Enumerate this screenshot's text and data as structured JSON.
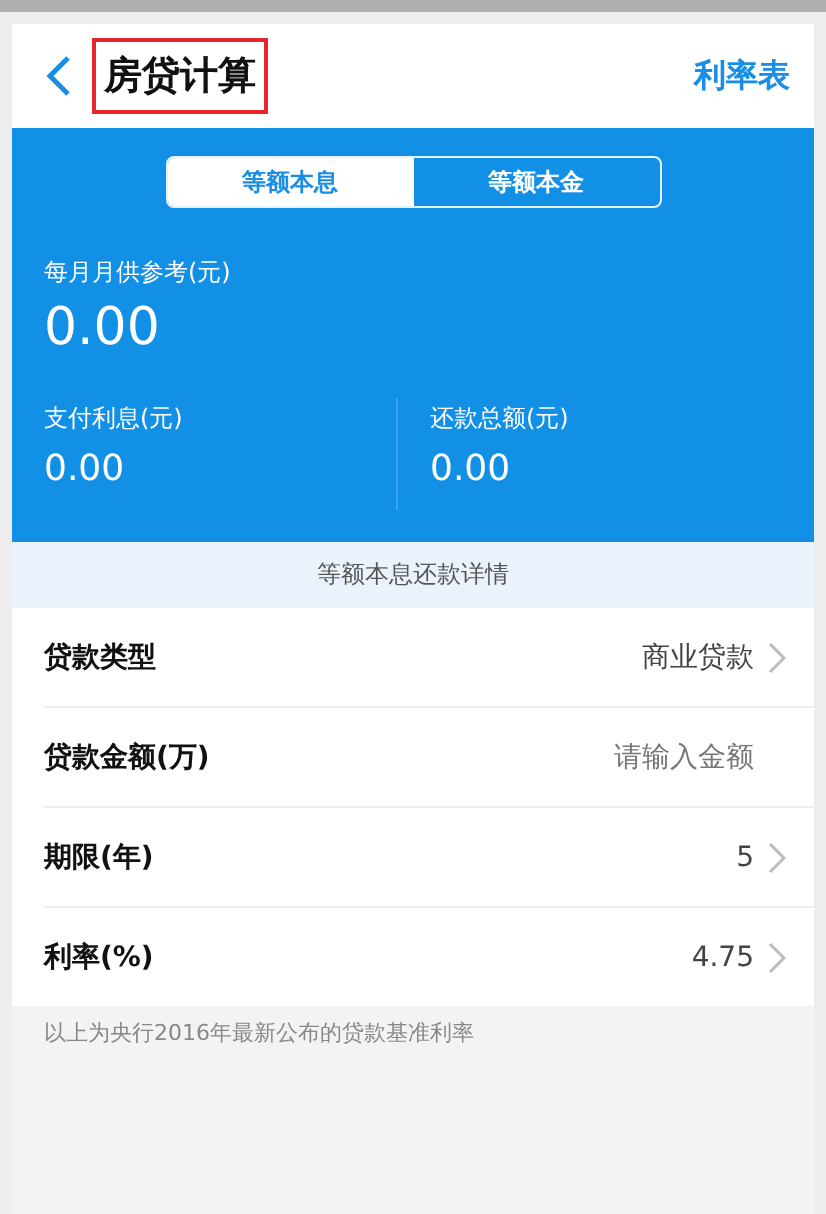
{
  "header": {
    "title": "房贷计算",
    "title_highlighted": true,
    "action": "利率表"
  },
  "tabs": [
    {
      "label": "等额本息",
      "selected": true
    },
    {
      "label": "等额本金",
      "selected": false
    }
  ],
  "summary": {
    "monthly_label": "每月月供参考(元)",
    "monthly_value": "0.00",
    "stats": [
      {
        "label": "支付利息(元)",
        "value": "0.00"
      },
      {
        "label": "还款总额(元)",
        "value": "0.00"
      }
    ]
  },
  "details_link": "等额本息还款详情",
  "rows": [
    {
      "kind": "select",
      "label": "贷款类型",
      "value": "商业贷款"
    },
    {
      "kind": "input",
      "label": "贷款金额(万)",
      "placeholder": "请输入金额"
    },
    {
      "kind": "select",
      "label": "期限(年)",
      "value": "5"
    },
    {
      "kind": "select",
      "label": "利率(%)",
      "value": "4.75"
    }
  ],
  "note": "以上为央行2016年最新公布的贷款基准利率"
}
